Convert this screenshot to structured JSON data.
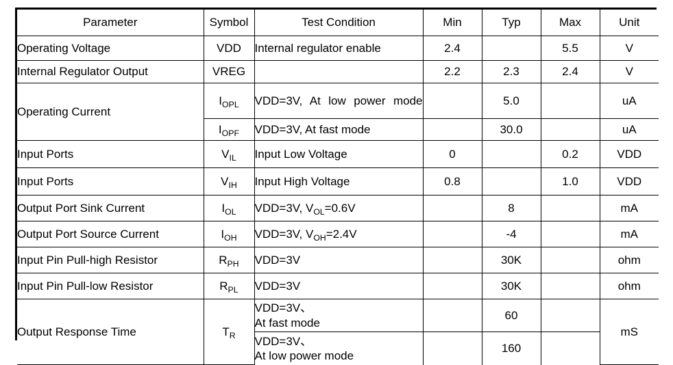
{
  "table": {
    "columns": [
      {
        "key": "parameter",
        "label": "Parameter"
      },
      {
        "key": "symbol",
        "label": "Symbol"
      },
      {
        "key": "condition",
        "label": "Test Condition"
      },
      {
        "key": "min",
        "label": "Min"
      },
      {
        "key": "typ",
        "label": "Typ"
      },
      {
        "key": "max",
        "label": "Max"
      },
      {
        "key": "unit",
        "label": "Unit"
      }
    ],
    "rows": [
      {
        "parameter": "Operating Voltage",
        "symbol": "VDD",
        "symbol_base": "VDD",
        "symbol_sub": "",
        "condition": "Internal regulator enable",
        "min": "2.4",
        "typ": "",
        "max": "5.5",
        "unit": "V"
      },
      {
        "parameter": "Internal Regulator Output",
        "symbol": "VREG",
        "symbol_base": "VREG",
        "symbol_sub": "",
        "condition": "",
        "min": "2.2",
        "typ": "2.3",
        "max": "2.4",
        "unit": "V"
      },
      {
        "parameter": "Operating Current",
        "symbol": "IOPL",
        "symbol_base": "I",
        "symbol_sub": "OPL",
        "condition": "VDD=3V, At low power mode",
        "condition_line1": "VDD=3V, At low power",
        "condition_line2": "mode",
        "min": "",
        "typ": "5.0",
        "max": "",
        "unit": "uA"
      },
      {
        "parameter": "",
        "symbol": "IOPF",
        "symbol_base": "I",
        "symbol_sub": "OPF",
        "condition": "VDD=3V, At fast mode",
        "min": "",
        "typ": "30.0",
        "max": "",
        "unit": "uA"
      },
      {
        "parameter": "Input Ports",
        "symbol": "VIL",
        "symbol_base": "V",
        "symbol_sub": "IL",
        "condition": "Input Low Voltage",
        "min": "0",
        "typ": "",
        "max": "0.2",
        "unit": "VDD"
      },
      {
        "parameter": "Input Ports",
        "symbol": "VIH",
        "symbol_base": "V",
        "symbol_sub": "IH",
        "condition": "Input High Voltage",
        "min": "0.8",
        "typ": "",
        "max": "1.0",
        "unit": "VDD"
      },
      {
        "parameter": "Output Port Sink Current",
        "symbol": "IOL",
        "symbol_base": "I",
        "symbol_sub": "OL",
        "condition": "VDD=3V, VOL=0.6V",
        "cond_pre": "VDD=3V, V",
        "cond_sub": "OL",
        "cond_post": "=0.6V",
        "min": "",
        "typ": "8",
        "max": "",
        "unit": "mA"
      },
      {
        "parameter": "Output Port Source Current",
        "symbol": "IOH",
        "symbol_base": "I",
        "symbol_sub": "OH",
        "condition": "VDD=3V, VOH=2.4V",
        "cond_pre": "VDD=3V, V",
        "cond_sub": "OH",
        "cond_post": "=2.4V",
        "min": "",
        "typ": "-4",
        "max": "",
        "unit": "mA"
      },
      {
        "parameter": "Input Pin Pull-high Resistor",
        "symbol": "RPH",
        "symbol_base": "R",
        "symbol_sub": "PH",
        "condition": "VDD=3V",
        "min": "",
        "typ": "30K",
        "max": "",
        "unit": "ohm"
      },
      {
        "parameter": "Input Pin Pull-low Resistor",
        "symbol": "RPL",
        "symbol_base": "R",
        "symbol_sub": "PL",
        "condition": "VDD=3V",
        "min": "",
        "typ": "30K",
        "max": "",
        "unit": "ohm"
      },
      {
        "parameter": "Output Response Time",
        "symbol": "TR",
        "symbol_base": "T",
        "symbol_sub": "R",
        "condition": "VDD=3V、 At fast mode",
        "condition_line1": "VDD=3V、",
        "condition_line2": "At fast mode",
        "min": "",
        "typ": "60",
        "max": "",
        "unit": "mS"
      },
      {
        "parameter": "",
        "symbol": "",
        "symbol_base": "",
        "symbol_sub": "",
        "condition": "VDD=3V、 At low power mode",
        "condition_line1": "VDD=3V、",
        "condition_line2": "At low power mode",
        "min": "",
        "typ": "160",
        "max": "",
        "unit": ""
      }
    ]
  }
}
